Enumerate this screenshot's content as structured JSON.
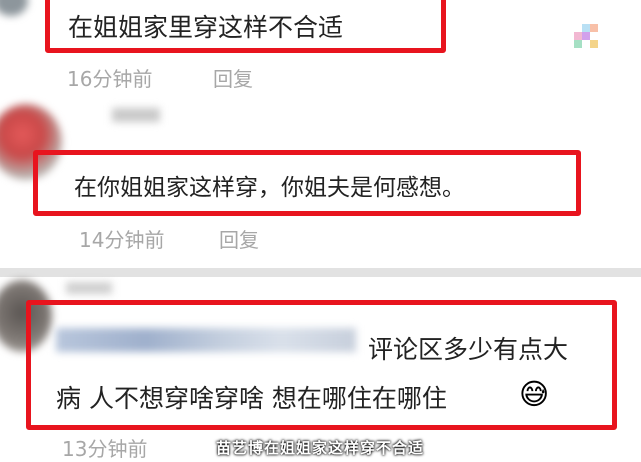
{
  "comments": [
    {
      "text": "在姐姐家里穿这样不合适",
      "time": "16分钟前",
      "reply_label": "回复"
    },
    {
      "text": "在你姐姐家这样穿，你姐夫是何感想。",
      "time": "14分钟前",
      "reply_label": "回复"
    },
    {
      "text_line1": "评论区多少有点大",
      "text_line2": "病 人不想穿啥穿啥 想在哪住在哪住",
      "emoji": "😅",
      "time": "13分钟前"
    }
  ],
  "subtitle": "苗艺博在姐姐家这样穿不合适",
  "colors": {
    "highlight_box": "#e8141e",
    "meta_text": "#a7a7a7",
    "separator": "#e2e2e2"
  }
}
